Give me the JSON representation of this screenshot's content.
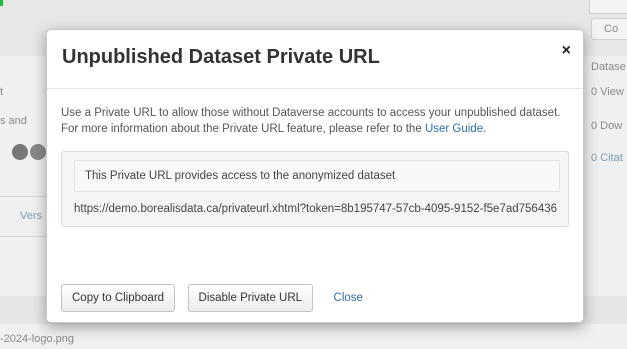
{
  "background": {
    "co_button": "Co",
    "left_fragments": [
      "t",
      "s and",
      "Vers"
    ],
    "right_fragments": [
      "Datase",
      "0 View",
      "0 Dow",
      "0 Citat"
    ],
    "bottom_fragment": "-2024-logo.png"
  },
  "modal": {
    "title": "Unpublished Dataset Private URL",
    "close_symbol": "×",
    "description_text": "Use a Private URL to allow those without Dataverse accounts to access your unpublished dataset. For more information about the Private URL feature, please refer to the",
    "description_link": "User Guide",
    "description_end": ".",
    "alert_text": "This Private URL provides access to the anonymized dataset",
    "private_url": "https://demo.borealisdata.ca/privateurl.xhtml?token=8b195747-57cb-4095-9152-f5e7ad756436",
    "buttons": {
      "copy": "Copy to Clipboard",
      "disable": "Disable Private URL",
      "close": "Close"
    }
  }
}
